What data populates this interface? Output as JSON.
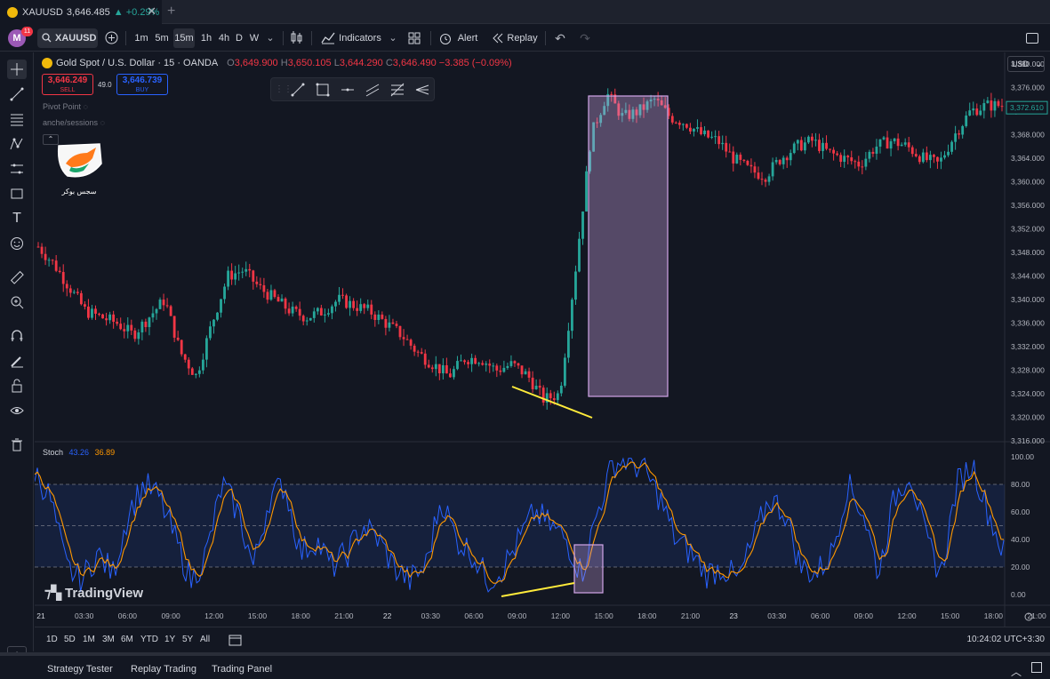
{
  "tab": {
    "symbol": "XAUUSD",
    "price": "3,646.485",
    "change": "▲ +0.29%"
  },
  "toolbar": {
    "avatar": "M",
    "notifications": "11",
    "symbol": "XAUUSD",
    "intervals": [
      "1m",
      "5m",
      "15m",
      "1h",
      "4h",
      "D",
      "W"
    ],
    "active_interval": "15m",
    "indicators": "Indicators",
    "alert": "Alert",
    "replay": "Replay"
  },
  "legend": {
    "title": "Gold Spot / U.S. Dollar · 15 · OANDA",
    "o_label": "O",
    "o": "3,649.900",
    "h_label": "H",
    "h": "3,650.105",
    "l_label": "L",
    "l": "3,644.290",
    "c_label": "C",
    "c": "3,646.490",
    "change": "−3.385 (−0.09%)"
  },
  "trade": {
    "sell_price": "3,646.249",
    "sell_label": "SELL",
    "spread": "49.0",
    "buy_price": "3,646.739",
    "buy_label": "BUY"
  },
  "indicators": {
    "pivot": "Pivot Point",
    "sessions": "anche/sessions"
  },
  "watermark_text": "سجس بوکر",
  "currency": "USD",
  "price_axis": {
    "labels": [
      "3,380.000",
      "3,376.000",
      "3,372.000",
      "3,368.000",
      "3,364.000",
      "3,360.000",
      "3,356.000",
      "3,352.000",
      "3,348.000",
      "3,344.000",
      "3,340.000",
      "3,336.000",
      "3,332.000",
      "3,328.000",
      "3,324.000",
      "3,320.000",
      "3,316.000"
    ],
    "last_price": "3,372.610"
  },
  "stoch": {
    "label": "Stoch",
    "k": "43.26",
    "d": "36.89",
    "axis": [
      "100.00",
      "80.00",
      "60.00",
      "40.00",
      "20.00",
      "0.00"
    ],
    "k_color": "#2962ff",
    "d_color": "#ff9800"
  },
  "time_axis": [
    "21",
    "03:30",
    "06:00",
    "09:00",
    "12:00",
    "15:00",
    "18:00",
    "21:00",
    "22",
    "03:30",
    "06:00",
    "09:00",
    "12:00",
    "15:00",
    "18:00",
    "21:00",
    "23",
    "03:30",
    "06:00",
    "09:00",
    "12:00",
    "15:00",
    "18:00",
    "21:00"
  ],
  "brand": "TradingView",
  "ranges": [
    "1D",
    "5D",
    "1M",
    "3M",
    "6M",
    "YTD",
    "1Y",
    "5Y",
    "All"
  ],
  "clock": "10:24:02 UTC+3:30",
  "panels": [
    "Strategy Tester",
    "Replay Trading",
    "Trading Panel"
  ],
  "colors": {
    "up": "#26a69a",
    "down": "#f23645",
    "highlight": "#d1a6e8",
    "annotation": "#ffeb3b"
  },
  "chart_data": {
    "type": "candlestick",
    "symbol": "XAUUSD",
    "timeframe": "15",
    "price_range": [
      3316,
      3382
    ],
    "close_path": [
      3349,
      3346,
      3342,
      3338,
      3337,
      3336,
      3334,
      3337,
      3340,
      3331,
      3327,
      3336,
      3344,
      3345,
      3342,
      3340,
      3338,
      3337,
      3338,
      3340,
      3339,
      3338,
      3336,
      3334,
      3331,
      3329,
      3327,
      3330,
      3330,
      3328,
      3329,
      3327,
      3323,
      3324,
      3345,
      3368,
      3375,
      3371,
      3372,
      3374,
      3371,
      3370,
      3368,
      3367,
      3364,
      3362,
      3361,
      3364,
      3366,
      3367,
      3365,
      3364,
      3363,
      3366,
      3367,
      3366,
      3364,
      3363,
      3368,
      3372,
      3373,
      3373
    ],
    "stoch_k": [
      90,
      70,
      20,
      10,
      30,
      15,
      60,
      80,
      70,
      40,
      10,
      30,
      80,
      60,
      20,
      70,
      80,
      30,
      40,
      20,
      30,
      50,
      40,
      20,
      10,
      20,
      70,
      40,
      30,
      10,
      20,
      40,
      60,
      50,
      40,
      15,
      60,
      95,
      98,
      90,
      70,
      40,
      30,
      15,
      20,
      10,
      40,
      70,
      60,
      20,
      15,
      30,
      80,
      60,
      15,
      70,
      90,
      40,
      15,
      80,
      95,
      60,
      30
    ]
  }
}
